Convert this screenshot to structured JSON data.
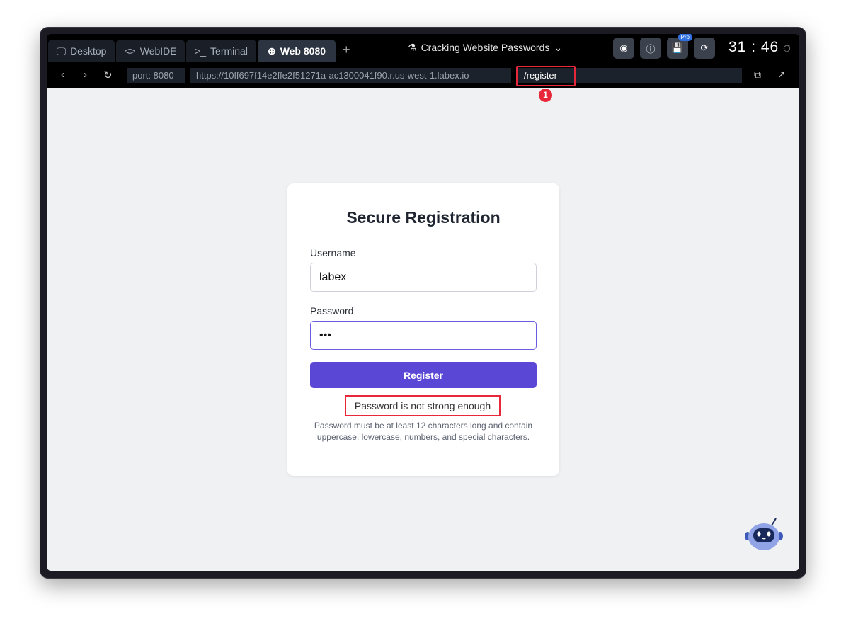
{
  "tabs": [
    {
      "label": "Desktop",
      "icon": "monitor-icon"
    },
    {
      "label": "WebIDE",
      "icon": "code-icon"
    },
    {
      "label": "Terminal",
      "icon": "terminal-icon"
    },
    {
      "label": "Web 8080",
      "icon": "globe-icon",
      "active": true
    }
  ],
  "lab_title": "Cracking Website Passwords",
  "pro_badge": "Pro",
  "timer": "31 : 46",
  "address": {
    "port": "port: 8080",
    "url": "https://10ff697f14e2ffe2f51271a-ac1300041f90.r.us-west-1.labex.io",
    "path": "/register"
  },
  "annotation_number": "1",
  "form": {
    "title": "Secure Registration",
    "username_label": "Username",
    "username_value": "labex",
    "password_label": "Password",
    "password_value": "•••",
    "register_label": "Register",
    "error": "Password is not strong enough",
    "help": "Password must be at least 12 characters long and contain uppercase, lowercase, numbers, and special characters."
  },
  "colors": {
    "accent": "#5a47d6",
    "highlight": "#e8283a"
  }
}
